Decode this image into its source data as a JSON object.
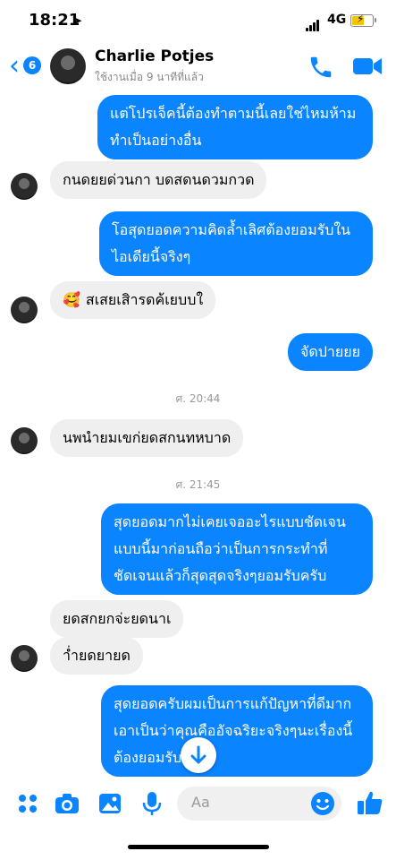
{
  "status_bar": {
    "time": "18:21",
    "location_arrow": "location-arrow-icon",
    "network": "4G",
    "battery": "battery-charging-icon"
  },
  "header": {
    "back_badge": "6",
    "contact_name": "Charlie Potjes",
    "active_status": "ใช้งานเมื่อ 9 นาทีที่แล้ว",
    "call_icon": "phone-icon",
    "video_icon": "video-camera-icon"
  },
  "messages": [
    {
      "side": "out",
      "text": "แต่โปรเจ็คนี้ต้องทำตามนี้เลยใช่ไหมห้ามทำเป็นอย่างอื่น"
    },
    {
      "side": "in",
      "text": "กนดยยด่วนกา บดสดนดวมกวด"
    },
    {
      "side": "out",
      "text": "โอสุดยอดความคิดล้ำเลิศต้องยอมรับในไอเดียนี้จริงๆ"
    },
    {
      "side": "in",
      "emoji": "🥰",
      "text": "สเสยเสิารดค้เยบบใ"
    },
    {
      "side": "out",
      "text": "จัดปายยย"
    },
    {
      "type": "timestamp",
      "text": "ศ. 20:44"
    },
    {
      "side": "in",
      "text": "นพนำยมเขก่ยดสกนทหบาด"
    },
    {
      "type": "timestamp",
      "text": "ศ. 21:45"
    },
    {
      "side": "out",
      "text": "สุดยอดมากไม่เคยเจออะไรแบบชัดเจนแบบนี้มาก่อนถือว่าเป็นการกระทำที่ชัดเจนแล้วก็สุดสุดจริงๆยอมรับครับ"
    },
    {
      "side": "in",
      "text": "ยดสกยกจ่ะยดนาเ"
    },
    {
      "side": "in",
      "text": "า่ำยดยายด"
    },
    {
      "side": "out",
      "text": "สุดยอดครับผมเป็นการแก้ปัญหาที่ดีมากเอาเป็นว่าคุณคืออัจฉริยะจริงๆนะเรื่องนี้ต้องยอมรับ"
    }
  ],
  "composer": {
    "placeholder": "Aa",
    "icons": [
      "grid-icon",
      "camera-icon",
      "gallery-icon",
      "microphone-icon",
      "emoji-icon",
      "thumbs-up-icon"
    ]
  },
  "colors": {
    "accent": "#0b84ff",
    "incoming_bubble": "#efefef"
  }
}
